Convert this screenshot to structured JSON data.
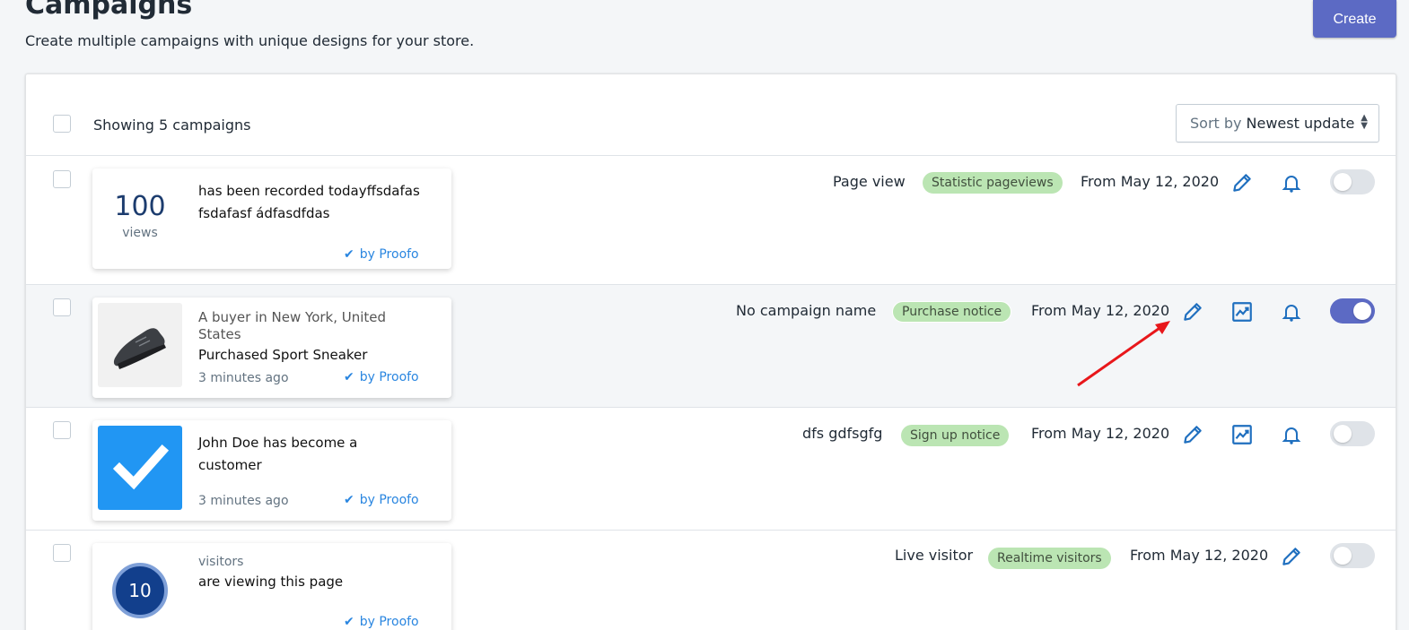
{
  "page": {
    "title": "Campaigns",
    "subtitle": "Create multiple campaigns with unique designs for your store.",
    "create_label": "Create"
  },
  "list": {
    "showing_text": "Showing 5 campaigns",
    "sort_label": "Sort by",
    "sort_value": "Newest update"
  },
  "campaigns": [
    {
      "big_number": "100",
      "number_label": "views",
      "message": "has been recorded todayffsdafas fsdafasf ádfasdfdas",
      "by": "by Proofo",
      "name": "Page view",
      "badge": "Statistic pageviews",
      "date": "From May 12, 2020",
      "enabled": false
    },
    {
      "location": "A buyer in New York, United States",
      "message": "Purchased Sport Sneaker",
      "time": "3 minutes ago",
      "by": "by Proofo",
      "name": "No campaign name",
      "badge": "Purchase notice",
      "date": "From May 12, 2020",
      "enabled": true
    },
    {
      "message": "John Doe has become a customer",
      "time": "3 minutes ago",
      "by": "by Proofo",
      "name": "dfs gdfsgfg",
      "badge": "Sign up notice",
      "date": "From May 12, 2020",
      "enabled": false
    },
    {
      "circle_number": "10",
      "label": "visitors",
      "message": "are viewing this page",
      "by": "by Proofo",
      "name": "Live visitor",
      "badge": "Realtime visitors",
      "date": "From May 12, 2020",
      "enabled": false
    }
  ],
  "colors": {
    "accent": "#5c6ac4",
    "badge_bg": "#bbe5b3",
    "link": "#2a86e0",
    "icon": "#1f6fbf",
    "annotation_arrow": "#e8171b"
  }
}
